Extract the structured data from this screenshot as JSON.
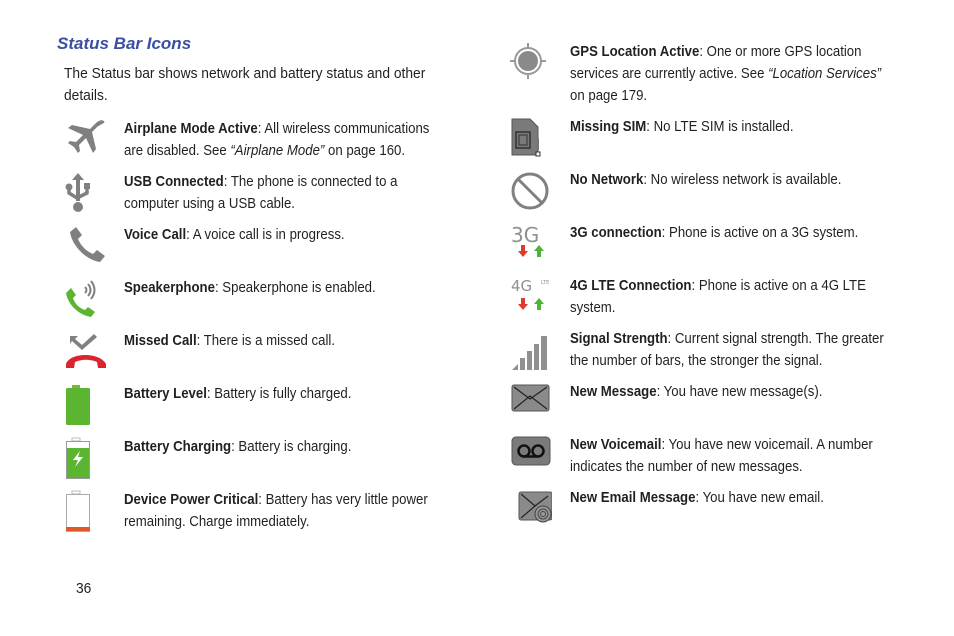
{
  "heading": "Status Bar Icons",
  "intro": "The Status bar shows network and battery status and other details.",
  "left_entries": [
    {
      "icon": "airplane-icon",
      "title": "Airplane Mode Active",
      "desc_before": ": All wireless communications are disabled. See ",
      "ref": "“Airplane Mode”",
      "desc_after": " on page 160."
    },
    {
      "icon": "usb-icon",
      "title": "USB Connected",
      "desc_before": ": The phone is connected to a computer using a USB cable.",
      "ref": "",
      "desc_after": ""
    },
    {
      "icon": "voice-call-icon",
      "title": "Voice Call",
      "desc_before": ": A voice call is in progress.",
      "ref": "",
      "desc_after": ""
    },
    {
      "icon": "speakerphone-icon",
      "title": "Speakerphone",
      "desc_before": ": Speakerphone is enabled.",
      "ref": "",
      "desc_after": ""
    },
    {
      "icon": "missed-call-icon",
      "title": "Missed Call",
      "desc_before": ": There is a missed call.",
      "ref": "",
      "desc_after": ""
    },
    {
      "icon": "battery-full-icon",
      "title": "Battery Level",
      "desc_before": ": Battery is fully charged.",
      "ref": "",
      "desc_after": ""
    },
    {
      "icon": "battery-charging-icon",
      "title": "Battery Charging",
      "desc_before": ": Battery is charging.",
      "ref": "",
      "desc_after": ""
    },
    {
      "icon": "battery-critical-icon",
      "title": "Device Power Critical",
      "desc_before": ": Battery has very little power remaining. Charge immediately.",
      "ref": "",
      "desc_after": ""
    }
  ],
  "right_entries": [
    {
      "icon": "gps-icon",
      "title": "GPS Location Active",
      "desc_before": ": One or more GPS location services are currently active. See ",
      "ref": "“Location Services”",
      "desc_after": " on page 179."
    },
    {
      "icon": "missing-sim-icon",
      "title": "Missing SIM",
      "desc_before": ": No LTE SIM is installed.",
      "ref": "",
      "desc_after": ""
    },
    {
      "icon": "no-network-icon",
      "title": "No Network",
      "desc_before": ": No wireless network is available.",
      "ref": "",
      "desc_after": ""
    },
    {
      "icon": "3g-icon",
      "title": "3G connection",
      "desc_before": ": Phone is active on a 3G system.",
      "ref": "",
      "desc_after": ""
    },
    {
      "icon": "4g-lte-icon",
      "title": "4G LTE Connection",
      "desc_before": ": Phone is active on a 4G LTE system.",
      "ref": "",
      "desc_after": ""
    },
    {
      "icon": "signal-strength-icon",
      "title": "Signal Strength",
      "desc_before": ": Current signal strength. The greater the number of bars, the stronger the signal.",
      "ref": "",
      "desc_after": ""
    },
    {
      "icon": "new-message-icon",
      "title": "New Message",
      "desc_before": ": You have new message(s).",
      "ref": "",
      "desc_after": ""
    },
    {
      "icon": "voicemail-icon",
      "title": "New Voicemail",
      "desc_before": ": You have new voicemail. A number indicates the number of new messages.",
      "ref": "",
      "desc_after": ""
    },
    {
      "icon": "email-icon",
      "title": "New Email Message",
      "desc_before": ": You have new email.",
      "ref": "",
      "desc_after": ""
    }
  ],
  "icon_labels": {
    "g3": "3G",
    "g4": "4G",
    "lte": "LTE"
  },
  "colors": {
    "heading": "#3a4ea3",
    "icon_gray": "#808080",
    "green": "#5cb531",
    "red": "#e03a2f",
    "orange": "#e0582a"
  },
  "page_number": "36"
}
